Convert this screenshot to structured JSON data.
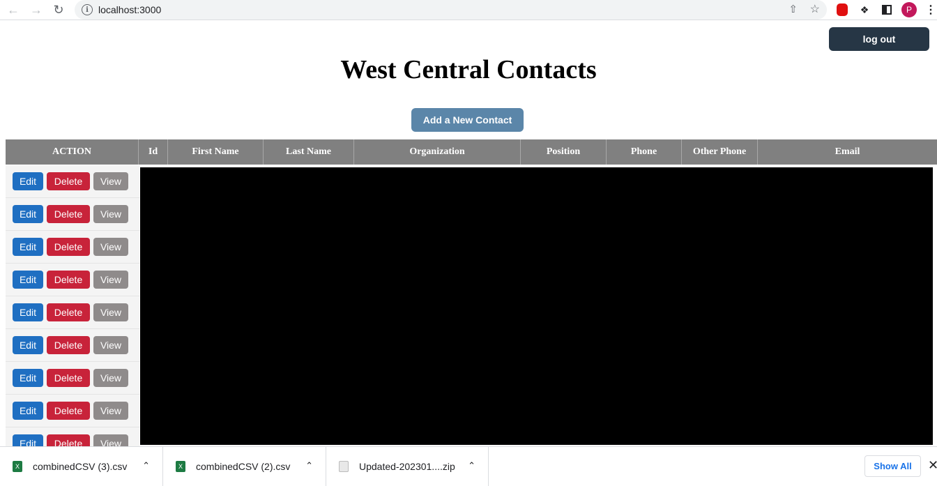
{
  "browser": {
    "url": "localhost:3000",
    "back_icon": "arrow-left-icon",
    "forward_icon": "arrow-right-icon",
    "reload_icon": "reload-icon",
    "avatar_letter": "P"
  },
  "header": {
    "logout_label": "log out",
    "title": "West Central Contacts",
    "add_label": "Add a New Contact"
  },
  "table": {
    "columns": [
      "ACTION",
      "Id",
      "First Name",
      "Last Name",
      "Organization",
      "Position",
      "Phone",
      "Other Phone",
      "Email"
    ],
    "rows": [
      {
        "edit": "Edit",
        "delete": "Delete",
        "view": "View"
      },
      {
        "edit": "Edit",
        "delete": "Delete",
        "view": "View"
      },
      {
        "edit": "Edit",
        "delete": "Delete",
        "view": "View"
      },
      {
        "edit": "Edit",
        "delete": "Delete",
        "view": "View"
      },
      {
        "edit": "Edit",
        "delete": "Delete",
        "view": "View"
      },
      {
        "edit": "Edit",
        "delete": "Delete",
        "view": "View"
      },
      {
        "edit": "Edit",
        "delete": "Delete",
        "view": "View"
      },
      {
        "edit": "Edit",
        "delete": "Delete",
        "view": "View"
      },
      {
        "edit": "Edit",
        "delete": "Delete",
        "view": "View"
      }
    ]
  },
  "downloads": {
    "items": [
      {
        "name": "combinedCSV (3).csv",
        "type": "xls"
      },
      {
        "name": "combinedCSV (2).csv",
        "type": "xls"
      },
      {
        "name": "Updated-202301....zip",
        "type": "zip"
      }
    ],
    "show_all_label": "Show All"
  },
  "colors": {
    "logout_bg": "#263645",
    "add_bg": "#5b86a9",
    "header_bg": "#808080",
    "edit_bg": "#1f6fc2",
    "delete_bg": "#c8233a",
    "view_bg": "#8f8b8b"
  }
}
